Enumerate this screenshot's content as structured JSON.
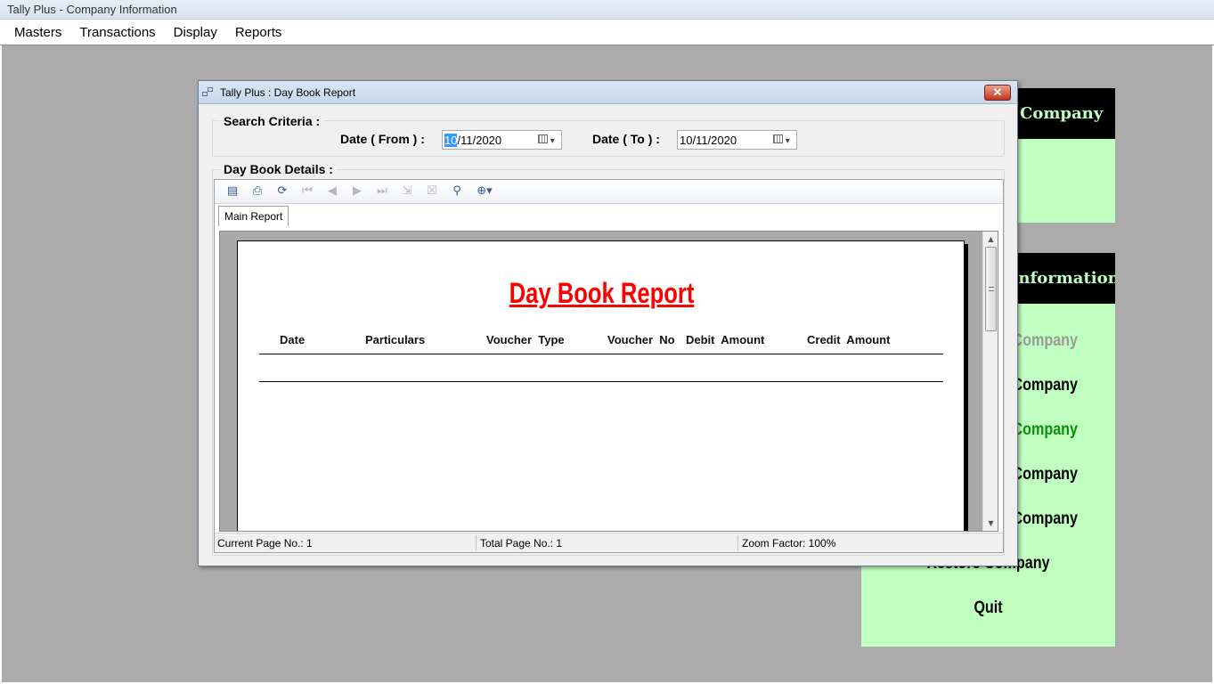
{
  "app": {
    "title": "Tally Plus - Company Information"
  },
  "menu": [
    "Masters",
    "Transactions",
    "Display",
    "Reports"
  ],
  "panels": {
    "top_header": "Company",
    "info_header": "Information",
    "options": [
      {
        "label": "Company",
        "state": "disabled"
      },
      {
        "label": "Company",
        "state": "normal"
      },
      {
        "label": "Company",
        "state": "active"
      },
      {
        "label": "Company",
        "state": "normal"
      },
      {
        "label": "Company",
        "state": "normal"
      },
      {
        "label": "Restore Company",
        "state": "normal"
      },
      {
        "label": "Quit",
        "state": "normal"
      }
    ],
    "colors": {
      "panel_bg": "#bfffbf",
      "header_bg": "#000000",
      "active_option": "#0d8f0d",
      "disabled_option": "#9a9a9a"
    }
  },
  "dialog": {
    "title": "Tally Plus : Day Book Report",
    "close_label": "✕",
    "search": {
      "legend": "Search Criteria :",
      "from_label": "Date ( From ) :",
      "from_value_selected": "10",
      "from_value_rest": "/11/2020",
      "to_label": "Date ( To ) :",
      "to_value": "10/11/2020"
    },
    "details": {
      "legend": "Day Book Details :"
    },
    "viewer": {
      "toolbar": [
        "export-icon",
        "print-icon",
        "refresh-icon",
        "first-page-icon",
        "prev-page-icon",
        "next-page-icon",
        "last-page-icon",
        "goto-page-icon",
        "close-view-icon",
        "find-icon",
        "zoom-icon"
      ],
      "tab": "Main Report",
      "report": {
        "title": "Day Book Report",
        "columns": [
          "Date",
          "Particulars",
          "Voucher  Type",
          "Voucher  No",
          "Debit  Amount",
          "Credit  Amount"
        ],
        "title_color": "#ff0000"
      },
      "status": {
        "current_page": "Current Page No.: 1",
        "total_pages": "Total Page No.: 1",
        "zoom": "Zoom Factor: 100%"
      }
    }
  }
}
